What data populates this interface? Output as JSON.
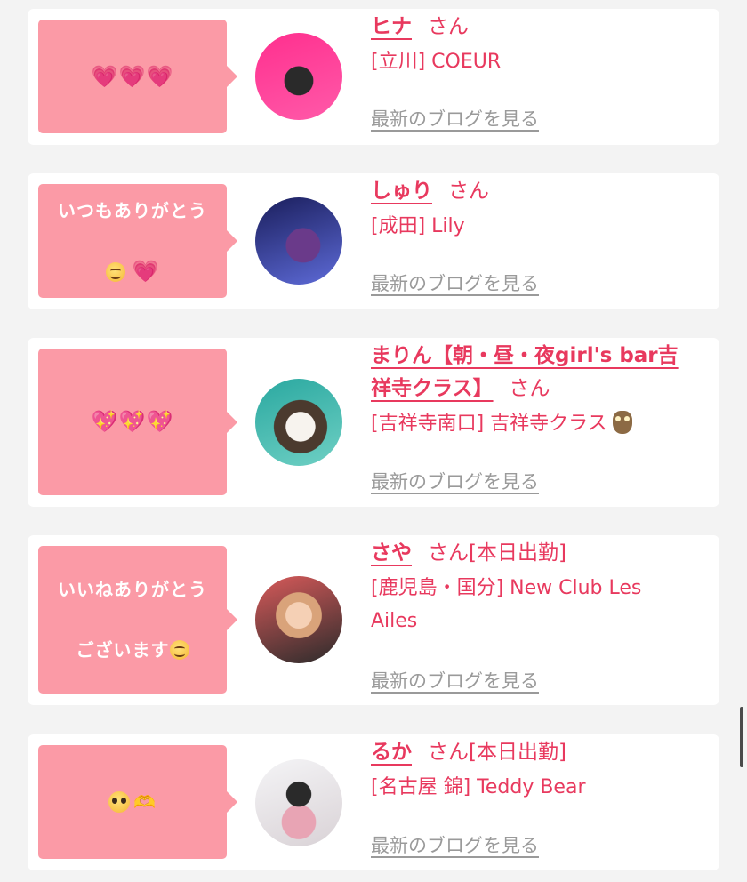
{
  "entries": [
    {
      "message_parts": [
        "heart",
        "heart",
        "heart"
      ],
      "name": "ヒナ",
      "honorific": "さん",
      "badge": "",
      "location": "[立川] COEUR",
      "blog_link": "最新のブログを見る",
      "avatar_colors": [
        "#ff2f8e",
        "#1b1b1b"
      ]
    },
    {
      "message_text": "いつもありがとう",
      "message_suffix": [
        "smile",
        "heart"
      ],
      "name": "しゅり",
      "honorific": "さん",
      "badge": "",
      "location": "[成田] Lily",
      "blog_link": "最新のブログを見る",
      "avatar_colors": [
        "#1a1e5c",
        "#5e6bd8"
      ]
    },
    {
      "message_parts": [
        "sparkling-heart",
        "sparkling-heart",
        "sparkling-heart"
      ],
      "name_line1": "まりん【朝・昼・夜girl's bar吉",
      "name_line2": "祥寺クラス】",
      "honorific": "さん",
      "badge": "",
      "location": "[吉祥寺南口] 吉祥寺クラス",
      "location_icon": "owl-emoji",
      "blog_link": "最新のブログを見る",
      "avatar_colors": [
        "#2aa8a0",
        "#e9e2d6"
      ]
    },
    {
      "message_line1": "いいねありがとう",
      "message_line2": "ございます",
      "message_suffix": [
        "smile"
      ],
      "name": "さや",
      "honorific": "さん",
      "badge": "[本日出勤]",
      "location_line1": "[鹿児島・国分] New Club Les",
      "location_line2": "Ailes",
      "blog_link": "最新のブログを見る",
      "avatar_colors": [
        "#c84b4b",
        "#f0c7a2"
      ]
    },
    {
      "message_parts": [
        "pleading-face",
        "heart-hands"
      ],
      "name": "るか",
      "honorific": "さん",
      "badge": "[本日出勤]",
      "location": "[名古屋 錦] Teddy Bear",
      "blog_link": "最新のブログを見る",
      "avatar_colors": [
        "#f1f1f3",
        "#c9a8b6"
      ]
    }
  ]
}
